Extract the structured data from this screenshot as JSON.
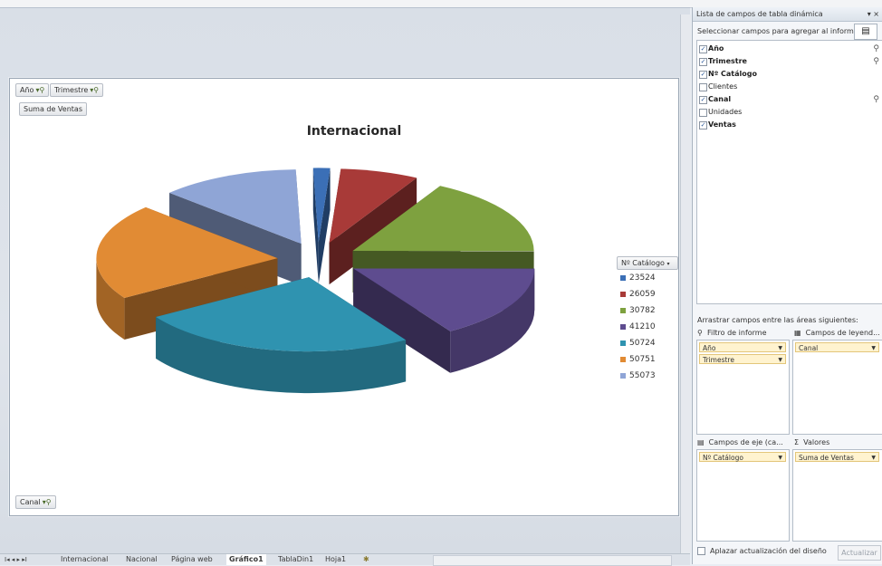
{
  "sheet": {
    "filters": [
      {
        "label": "Año"
      },
      {
        "label": "Trimestre"
      }
    ],
    "value_button": "Suma de Ventas",
    "axis_button": "Canal",
    "legend_field": "Nº Catálogo"
  },
  "chart_data": {
    "type": "pie",
    "title": "Internacional",
    "categories": [
      "23524",
      "26059",
      "30782",
      "41210",
      "50724",
      "50751",
      "55073"
    ],
    "values": [
      1.5,
      7,
      17,
      16,
      25,
      21,
      12.5
    ],
    "colors": [
      "#3b6fb6",
      "#a83a38",
      "#7ea13f",
      "#5e4c8f",
      "#2f93b0",
      "#e18b34",
      "#8fa5d6"
    ],
    "legend_position": "right",
    "style": "3d-exploded"
  },
  "sheet_tabs": [
    "Internacional",
    "Nacional",
    "Página web",
    "Gráfico1",
    "TablaDin1",
    "Hoja1"
  ],
  "active_tab": "Gráfico1",
  "panel": {
    "title": "Lista de campos de tabla dinámica",
    "select_label": "Seleccionar campos para agregar al informe:",
    "fields": [
      {
        "label": "Año",
        "checked": true,
        "filtered": true
      },
      {
        "label": "Trimestre",
        "checked": true,
        "filtered": true
      },
      {
        "label": "Nº Catálogo",
        "checked": true,
        "filtered": false
      },
      {
        "label": "Clientes",
        "checked": false,
        "filtered": false
      },
      {
        "label": "Canal",
        "checked": true,
        "filtered": true
      },
      {
        "label": "Unidades",
        "checked": false,
        "filtered": false
      },
      {
        "label": "Ventas",
        "checked": true,
        "filtered": false
      }
    ],
    "drag_label": "Arrastrar campos entre las áreas siguientes:",
    "areas": {
      "report_filter": {
        "title": "Filtro de informe",
        "items": [
          "Año",
          "Trimestre"
        ]
      },
      "legend_fields": {
        "title": "Campos de leyend...",
        "items": [
          "Canal"
        ]
      },
      "axis_fields": {
        "title": "Campos de eje (ca...",
        "items": [
          "Nº Catálogo"
        ]
      },
      "values": {
        "title": "Valores",
        "items": [
          "Suma de Ventas"
        ]
      }
    },
    "defer_label": "Aplazar actualización del diseño",
    "update_button": "Actualizar"
  }
}
